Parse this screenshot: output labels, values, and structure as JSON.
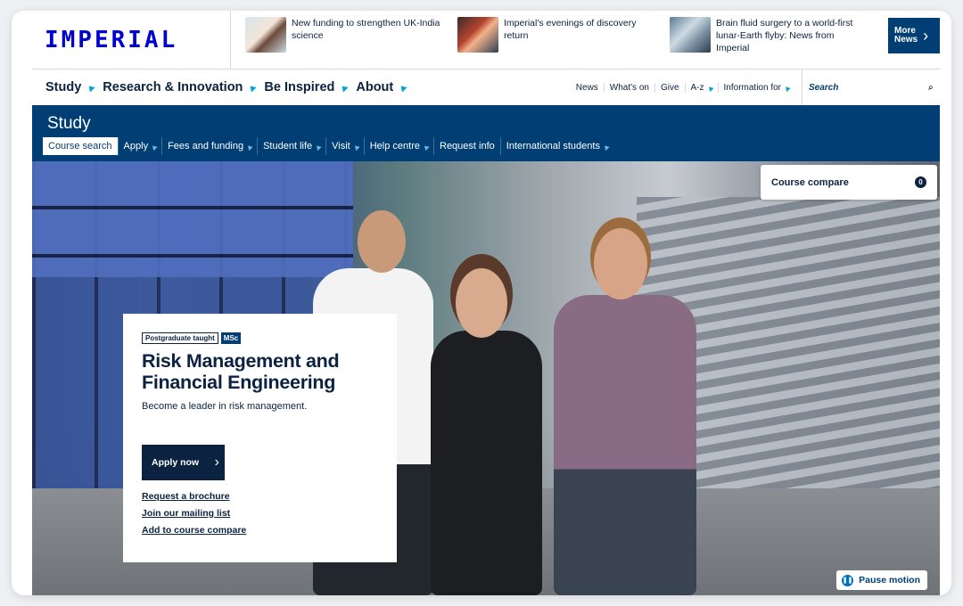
{
  "brand": {
    "logo": "IMPERIAL"
  },
  "news": {
    "items": [
      {
        "text": "New funding to strengthen UK-India science"
      },
      {
        "text": "Imperial's evenings of discovery return"
      },
      {
        "text": "Brain fluid surgery to a world-first lunar-Earth flyby: News from Imperial"
      }
    ],
    "more_label_1": "More",
    "more_label_2": "News"
  },
  "nav": {
    "primary": [
      "Study",
      "Research & Innovation",
      "Be Inspired",
      "About"
    ],
    "utility": [
      "News",
      "What's on",
      "Give",
      "A-z",
      "Information for"
    ],
    "search_placeholder": "Search"
  },
  "study": {
    "title": "Study",
    "subnav": [
      "Course search",
      "Apply",
      "Fees and funding",
      "Student life",
      "Visit",
      "Help centre",
      "Request info",
      "International students"
    ]
  },
  "compare": {
    "label": "Course compare",
    "count": "0"
  },
  "course": {
    "tag1": "Postgraduate taught",
    "tag2": "MSc",
    "title": "Risk Management and Financial Engineering",
    "subtitle": "Become a leader in risk management.",
    "apply_label": "Apply now",
    "links": [
      "Request a brochure",
      "Join our mailing list",
      "Add to course compare"
    ]
  },
  "motion": {
    "pause_label": "Pause motion"
  },
  "colors": {
    "brand_blue": "#0000cd",
    "navy": "#003e74",
    "dark": "#0b2240",
    "accent": "#00a6d6"
  }
}
